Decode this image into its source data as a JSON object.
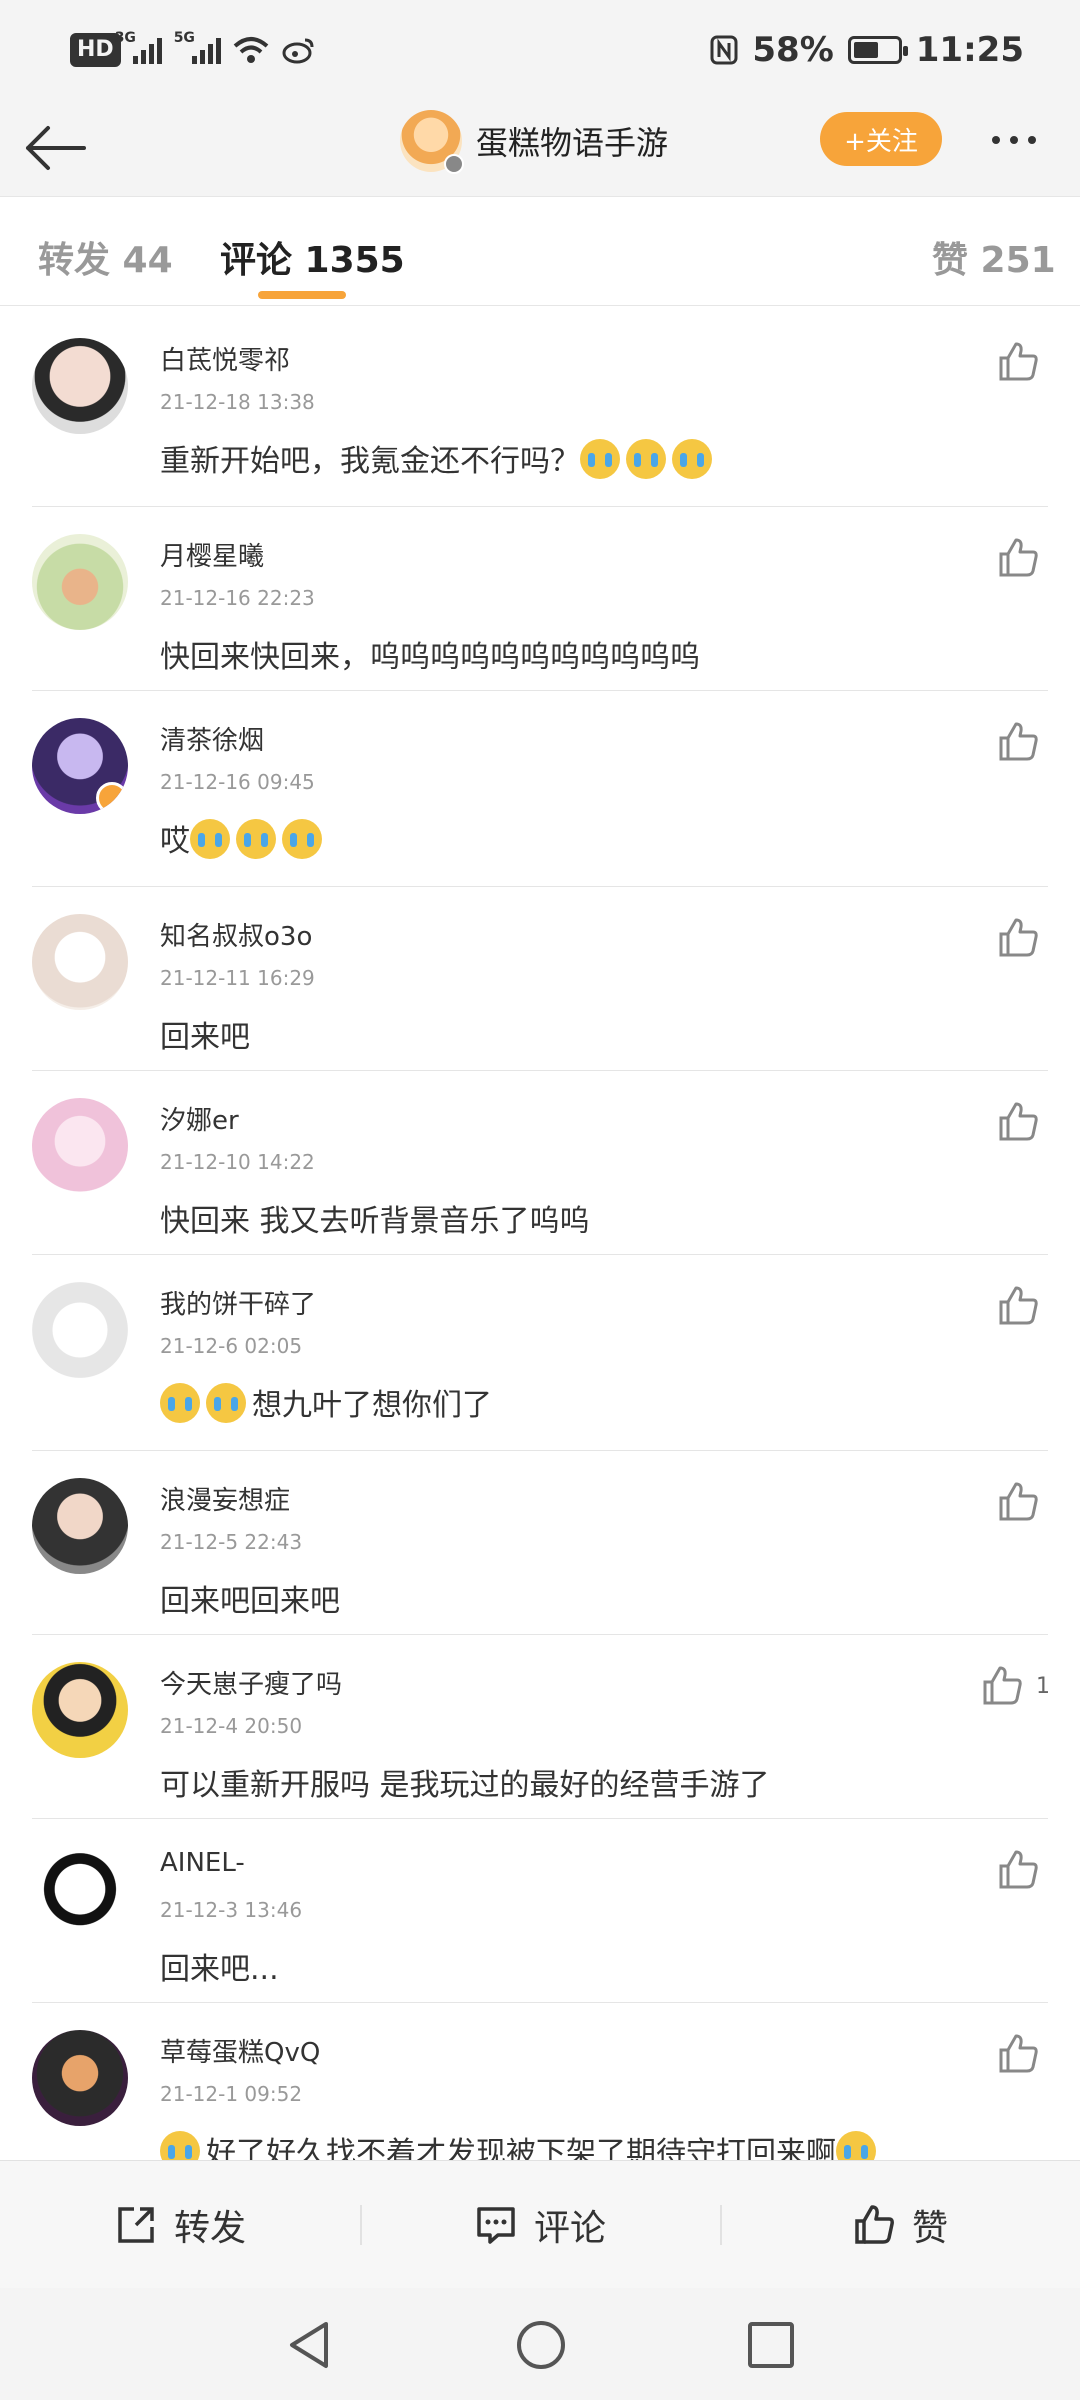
{
  "status_bar": {
    "hd": "HD",
    "sim1": "3G",
    "sim2": "5G",
    "battery_percent": "58%",
    "battery_level": 0.58,
    "time": "11:25",
    "icons": [
      "hd-icon",
      "signal-icon",
      "wifi-icon",
      "weibo-icon",
      "nfc-icon",
      "battery-icon"
    ]
  },
  "header": {
    "title": "蛋糕物语手游",
    "follow_label": "+关注",
    "accent_color": "#f7a43a"
  },
  "tabs": {
    "repost": "转发 44",
    "comment": "评论 1355",
    "likes": "赞 251"
  },
  "comments": [
    {
      "name": "白茋悦零祁",
      "time": "21-12-18 13:38",
      "text": "重新开始吧，我氪金还不行吗？",
      "emoji_after": 3,
      "likes": ""
    },
    {
      "name": "月樱星曦",
      "time": "21-12-16 22:23",
      "text": "快回来快回来，呜呜呜呜呜呜呜呜呜呜呜",
      "emoji_after": 0,
      "likes": ""
    },
    {
      "name": "清茶徐烟",
      "time": "21-12-16 09:45",
      "text": "哎",
      "emoji_after": 3,
      "likes": ""
    },
    {
      "name": "知名叔叔o3o",
      "time": "21-12-11 16:29",
      "text": "回来吧",
      "emoji_after": 0,
      "likes": ""
    },
    {
      "name": "汐娜er",
      "time": "21-12-10 14:22",
      "text": "快回来  我又去听背景音乐了呜呜",
      "emoji_after": 0,
      "likes": ""
    },
    {
      "name": "我的饼干碎了",
      "time": "21-12-6 02:05",
      "text": "想九叶了想你们了",
      "emoji_before": 2,
      "likes": ""
    },
    {
      "name": "浪漫妄想症",
      "time": "21-12-5 22:43",
      "text": "回来吧回来吧",
      "emoji_after": 0,
      "likes": ""
    },
    {
      "name": "今天崽子瘦了吗",
      "time": "21-12-4 20:50",
      "text": "可以重新开服吗 是我玩过的最好的经营手游了",
      "emoji_after": 0,
      "likes": "1"
    },
    {
      "name": "AINEL-",
      "time": "21-12-3 13:46",
      "text": "回来吧...",
      "emoji_after": 0,
      "likes": ""
    },
    {
      "name": "草莓蛋糕QvQ",
      "time": "21-12-1 09:52",
      "text": "好了好久找不着才发现被下架了期待守打回来啊",
      "emoji_before": 1,
      "emoji_after": 1,
      "likes": ""
    }
  ],
  "actions": {
    "repost": "转发",
    "comment": "评论",
    "like": "赞"
  }
}
